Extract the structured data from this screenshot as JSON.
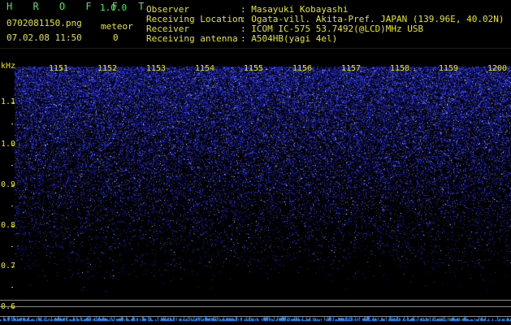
{
  "app": {
    "name": "H R O F F T",
    "version": "1.0.0",
    "filename": "0702081150.png",
    "datetime": "07.02.08 11:50",
    "meteor_label": "meteor",
    "meteor_count": "0"
  },
  "info": [
    {
      "label": "Observer",
      "value": ": Masayuki Kobayashi"
    },
    {
      "label": "Receiving Location",
      "value": ": Ogata-vill. Akita-Pref. JAPAN (139.96E, 40.02N)"
    },
    {
      "label": "Receiver",
      "value": ": ICOM IC-575 53.7492(@LCD)MHz USB"
    },
    {
      "label": "Receiving antenna",
      "value": ": A504HB(yagi 4el)"
    }
  ],
  "chart_data": {
    "type": "heatmap",
    "ylabel": "kHz",
    "y_ticks": [
      "1.1",
      "1.0",
      "0.9",
      "0.8",
      "0.7",
      "0.6"
    ],
    "x_ticks": [
      "1151",
      "1152",
      "1153",
      "1154",
      "1155",
      "1156",
      "1157",
      "1158",
      "1159",
      "1200"
    ],
    "colors": {
      "signal": "#3040ff",
      "bright": "#a0b8ff",
      "background": "#000000",
      "text": "#e8e800",
      "title": "#3cf03c",
      "ref_line": "#8a8a8a",
      "base_line": "#3aa0ff"
    }
  }
}
